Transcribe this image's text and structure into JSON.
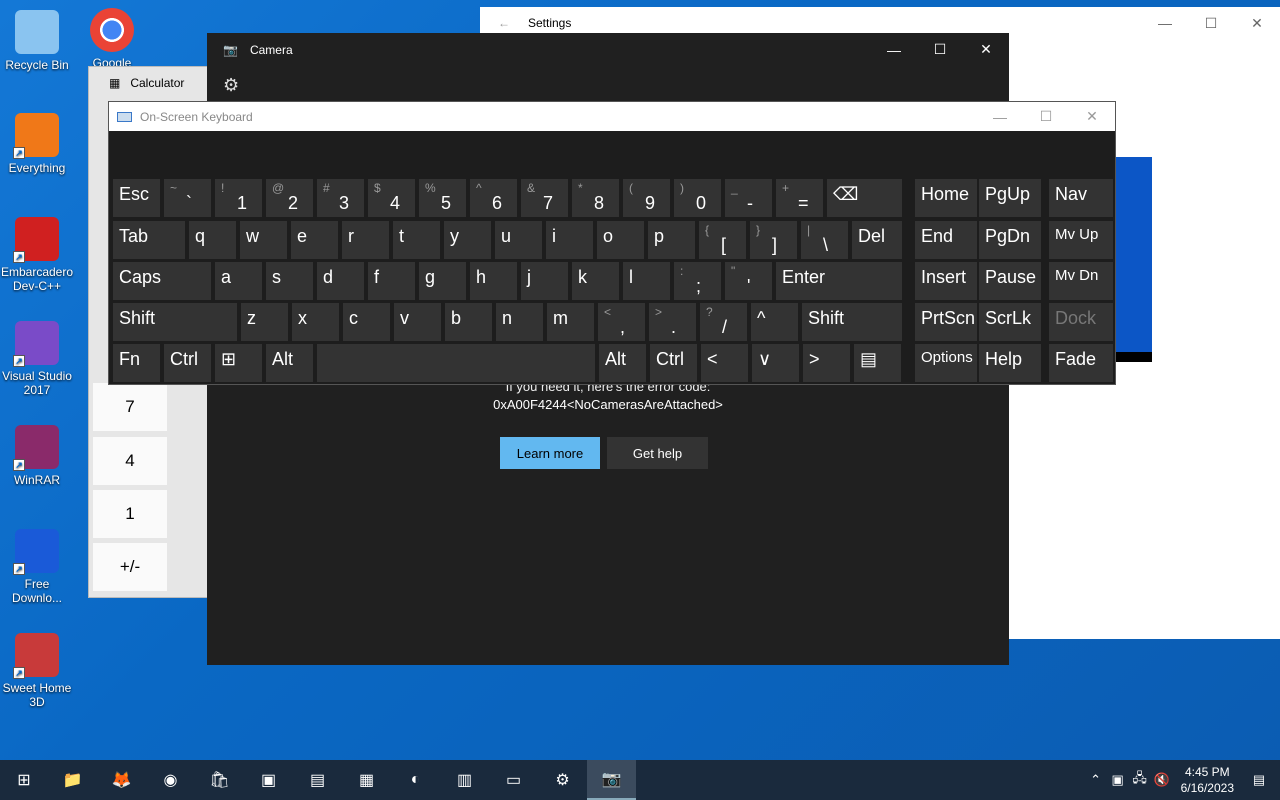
{
  "desktop_icons": [
    {
      "label": "Recycle Bin",
      "icon": "recycle-bin-icon",
      "color": "#8ac4f0"
    },
    {
      "label": "Everything",
      "icon": "search-magnifier-icon",
      "color": "#f07818"
    },
    {
      "label": "Embarcadero Dev-C++",
      "icon": "devcpp-icon",
      "color": "#d02020"
    },
    {
      "label": "Visual Studio 2017",
      "icon": "visual-studio-icon",
      "color": "#7a4bc8"
    },
    {
      "label": "WinRAR",
      "icon": "winrar-icon",
      "color": "#8a2a6a"
    },
    {
      "label": "Free Downlo...",
      "icon": "free-download-manager-icon",
      "color": "#1a5ad8"
    },
    {
      "label": "Sweet Home 3D",
      "icon": "sweet-home-3d-icon",
      "color": "#c83a3a"
    }
  ],
  "chrome_icon_label": "Google",
  "settings": {
    "title": "Settings",
    "back": "←",
    "min": "—",
    "max": "☐",
    "close": "✕"
  },
  "calculator": {
    "title": "Calculator",
    "keys": [
      "7",
      "4",
      "1",
      "+/-"
    ]
  },
  "camera": {
    "title": "Camera",
    "min": "—",
    "max": "☐",
    "close": "✕",
    "gear": "⚙",
    "error_line1": "If you need it, here's the error code:",
    "error_line2": "0xA00F4244<NoCamerasAreAttached>",
    "learn_more": "Learn more",
    "get_help": "Get help"
  },
  "osk": {
    "title": "On-Screen Keyboard",
    "min": "—",
    "max": "☐",
    "close": "✕",
    "row1": [
      {
        "m": "Esc"
      },
      {
        "s": "~",
        "n": "`"
      },
      {
        "s": "!",
        "n": "1"
      },
      {
        "s": "@",
        "n": "2"
      },
      {
        "s": "#",
        "n": "3"
      },
      {
        "s": "$",
        "n": "4"
      },
      {
        "s": "%",
        "n": "5"
      },
      {
        "s": "^",
        "n": "6"
      },
      {
        "s": "&",
        "n": "7"
      },
      {
        "s": "*",
        "n": "8"
      },
      {
        "s": "(",
        "n": "9"
      },
      {
        "s": ")",
        "n": "0"
      },
      {
        "s": "_",
        "n": "-"
      },
      {
        "s": "+",
        "n": "="
      },
      {
        "m": "⌫"
      }
    ],
    "row2": [
      "Tab",
      "q",
      "w",
      "e",
      "r",
      "t",
      "y",
      "u",
      "i",
      "o",
      "p",
      {
        "s": "{",
        "n": "["
      },
      {
        "s": "}",
        "n": "]"
      },
      {
        "s": "|",
        "n": "\\"
      },
      "Del"
    ],
    "row3": [
      "Caps",
      "a",
      "s",
      "d",
      "f",
      "g",
      "h",
      "j",
      "k",
      "l",
      {
        "s": ":",
        "n": ";"
      },
      {
        "s": "\"",
        "n": "'"
      },
      "Enter"
    ],
    "row4": [
      "Shift",
      "z",
      "x",
      "c",
      "v",
      "b",
      "n",
      "m",
      {
        "s": "<",
        "n": ","
      },
      {
        "s": ">",
        "n": "."
      },
      {
        "s": "?",
        "n": "/"
      },
      "^",
      "Shift"
    ],
    "row5": [
      "Fn",
      "Ctrl",
      "⊞",
      "Alt",
      "",
      "Alt",
      "Ctrl",
      "<",
      "∨",
      ">",
      "▤"
    ],
    "nav": [
      [
        "Home",
        "PgUp",
        "Nav"
      ],
      [
        "End",
        "PgDn",
        "Mv Up"
      ],
      [
        "Insert",
        "Pause",
        "Mv Dn"
      ],
      [
        "PrtScn",
        "ScrLk",
        "Dock"
      ],
      [
        "Options",
        "Help",
        "Fade"
      ]
    ]
  },
  "taskbar": {
    "start": "⊞",
    "apps": [
      {
        "name": "file-explorer-icon",
        "glyph": "📁"
      },
      {
        "name": "firefox-icon",
        "glyph": "🦊"
      },
      {
        "name": "chrome-icon",
        "glyph": "◉"
      },
      {
        "name": "store-icon",
        "glyph": "🛍"
      },
      {
        "name": "app-purple-icon",
        "glyph": "▣"
      },
      {
        "name": "app-gray-icon",
        "glyph": "▤"
      },
      {
        "name": "calculator-icon",
        "glyph": "▦"
      },
      {
        "name": "edge-icon",
        "glyph": "◐"
      },
      {
        "name": "calendar-icon",
        "glyph": "▥"
      },
      {
        "name": "remote-desktop-icon",
        "glyph": "▭"
      },
      {
        "name": "settings-icon",
        "glyph": "⚙"
      },
      {
        "name": "camera-icon",
        "glyph": "📷"
      }
    ],
    "time": "4:45 PM",
    "date": "6/16/2023",
    "tray_up": "⌃",
    "notifications": "▤"
  }
}
